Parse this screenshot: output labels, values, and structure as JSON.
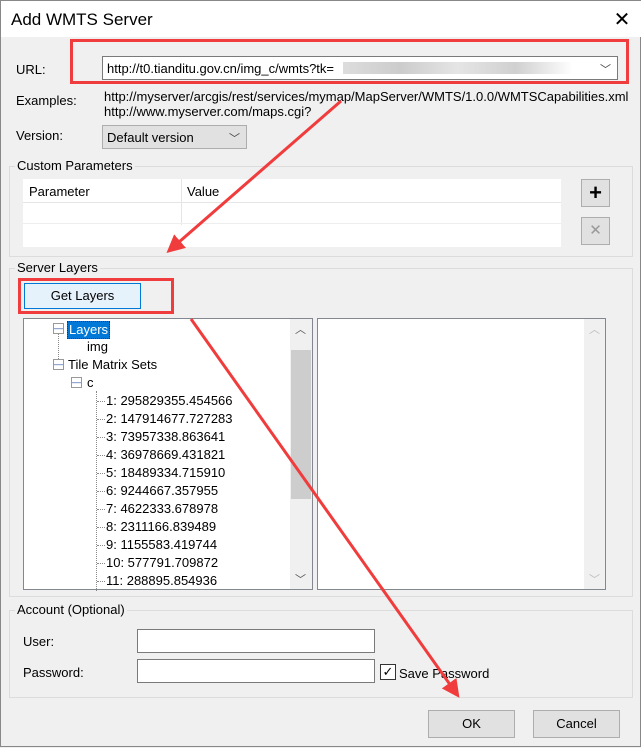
{
  "window": {
    "title": "Add WMTS Server"
  },
  "url": {
    "label": "URL:",
    "value": "http://t0.tianditu.gov.cn/img_c/wmts?tk="
  },
  "examples": {
    "label": "Examples:",
    "lines": [
      "http://myserver/arcgis/rest/services/mymap/MapServer/WMTS/1.0.0/WMTSCapabilities.xml",
      "http://www.myserver.com/maps.cgi?"
    ]
  },
  "version": {
    "label": "Version:",
    "value": "Default version"
  },
  "custom_parameters": {
    "label": "Custom Parameters",
    "columns": [
      "Parameter",
      "Value"
    ],
    "add_icon": "plus-icon",
    "remove_icon": "x-icon"
  },
  "server_layers": {
    "label": "Server Layers",
    "get_layers": "Get Layers",
    "tree": {
      "layers": "Layers",
      "layer_items": [
        "img"
      ],
      "tile_matrix_sets": "Tile Matrix Sets",
      "set": "c",
      "levels": [
        "1: 295829355.454566",
        "2: 147914677.727283",
        "3: 73957338.863641",
        "4: 36978669.431821",
        "5: 18489334.715910",
        "6: 9244667.357955",
        "7: 4622333.678978",
        "8: 2311166.839489",
        "9: 1155583.419744",
        "10: 577791.709872",
        "11: 288895.854936"
      ]
    }
  },
  "account": {
    "label": "Account (Optional)",
    "user_label": "User:",
    "password_label": "Password:",
    "save_password": "Save Password",
    "save_password_checked": true
  },
  "buttons": {
    "ok": "OK",
    "cancel": "Cancel"
  },
  "colors": {
    "annotation": "#f03c3c",
    "selection": "#0078d7"
  }
}
